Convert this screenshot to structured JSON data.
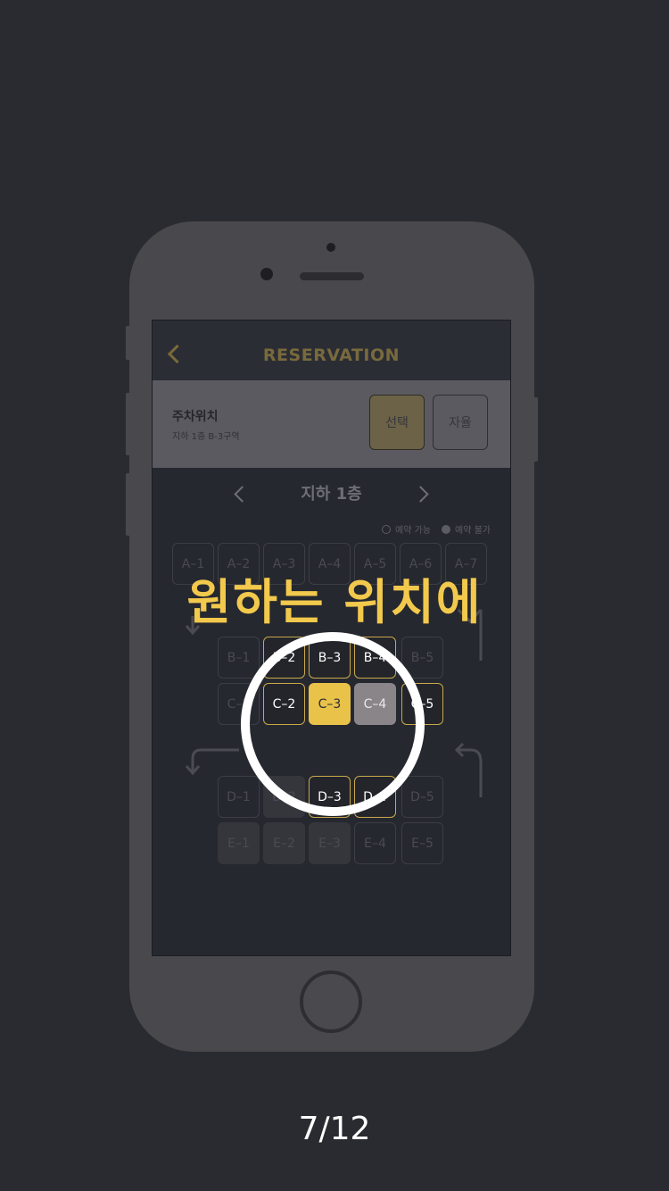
{
  "nav": {
    "title": "RESERVATION"
  },
  "parking_info": {
    "title": "주차위치",
    "subtitle": "지하 1층 B-3구역"
  },
  "options": {
    "select_label": "선택",
    "auto_label": "자율"
  },
  "floor": {
    "label": "지하 1층"
  },
  "legend": {
    "available": "예약 가능",
    "unavailable": "예약 불가"
  },
  "slots": [
    {
      "id": "A-1",
      "state": "dim"
    },
    {
      "id": "A-2",
      "state": "dim"
    },
    {
      "id": "A-3",
      "state": "dim"
    },
    {
      "id": "A-4",
      "state": "dim"
    },
    {
      "id": "A-5",
      "state": "dim"
    },
    {
      "id": "A-6",
      "state": "dim"
    },
    {
      "id": "A-7",
      "state": "dim"
    },
    {
      "id": "B-1",
      "state": "dim"
    },
    {
      "id": "B-2",
      "state": "bright"
    },
    {
      "id": "B-3",
      "state": "bright"
    },
    {
      "id": "B-4",
      "state": "bright"
    },
    {
      "id": "B-5",
      "state": "dim"
    },
    {
      "id": "C-1",
      "state": "dim"
    },
    {
      "id": "C-2",
      "state": "bright"
    },
    {
      "id": "C-3",
      "state": "selected"
    },
    {
      "id": "C-4",
      "state": "taken"
    },
    {
      "id": "C-5",
      "state": "bright"
    },
    {
      "id": "D-1",
      "state": "dim"
    },
    {
      "id": "D-2",
      "state": "dim-fill"
    },
    {
      "id": "D-3",
      "state": "bright"
    },
    {
      "id": "D-4",
      "state": "bright"
    },
    {
      "id": "D-5",
      "state": "dim"
    },
    {
      "id": "E-1",
      "state": "dim-fill"
    },
    {
      "id": "E-2",
      "state": "dim-fill"
    },
    {
      "id": "E-3",
      "state": "dim-fill"
    },
    {
      "id": "E-4",
      "state": "dim"
    },
    {
      "id": "E-5",
      "state": "dim"
    }
  ],
  "headline": "원하는 위치에",
  "page_indicator": "7/12",
  "colors": {
    "accent": "#f2c94c",
    "background": "#2a2b31",
    "selected_slot": "#e9c24a",
    "taken_slot": "#8a8589"
  }
}
